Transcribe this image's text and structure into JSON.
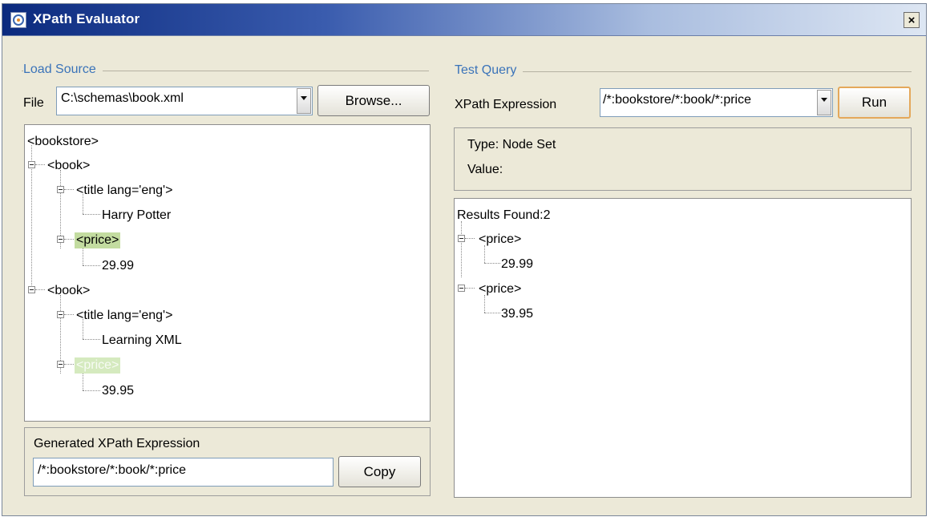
{
  "window": {
    "title": "XPath Evaluator",
    "close_glyph": "×"
  },
  "load_source": {
    "group_label": "Load Source",
    "file_label": "File",
    "file_value": "C:\\schemas\\book.xml",
    "browse_label": "Browse...",
    "tree": [
      {
        "text": "<bookstore>"
      },
      {
        "text": "<book>"
      },
      {
        "text": "<title lang='eng'>"
      },
      {
        "text": "Harry Potter"
      },
      {
        "text": "<price>",
        "highlight": true
      },
      {
        "text": "29.99"
      },
      {
        "text": "<book>"
      },
      {
        "text": "<title lang='eng'>"
      },
      {
        "text": "Learning XML"
      },
      {
        "text": "<price>",
        "highlight": true
      },
      {
        "text": "39.95"
      }
    ]
  },
  "generated": {
    "label": "Generated XPath Expression",
    "value": "/*:bookstore/*:book/*:price",
    "copy_label": "Copy"
  },
  "test_query": {
    "group_label": "Test Query",
    "expression_label": "XPath Expression",
    "expression_value": "/*:bookstore/*:book/*:price",
    "run_label": "Run",
    "type_text": "Type: Node Set",
    "value_text": "Value:",
    "results_header": "Results Found:2",
    "results": [
      {
        "text": "<price>"
      },
      {
        "text": "29.99"
      },
      {
        "text": "<price>"
      },
      {
        "text": "39.95"
      }
    ]
  },
  "colors": {
    "highlight": "#c3dca0",
    "group_label": "#3a73b9",
    "title_bar": "#0b2a7e"
  }
}
